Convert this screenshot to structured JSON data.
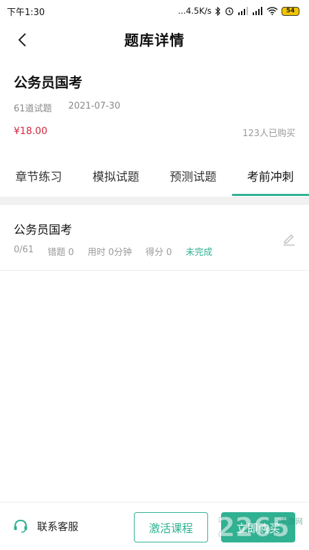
{
  "status_bar": {
    "time": "下午1:30",
    "network_speed": "...4.5K/s",
    "battery": "54"
  },
  "header": {
    "title": "题库详情"
  },
  "bank": {
    "title": "公务员国考",
    "question_count": "61道试题",
    "date": "2021-07-30",
    "price": "¥18.00",
    "buyers": "123人已购买"
  },
  "tabs": [
    {
      "label": "章节练习"
    },
    {
      "label": "模拟试题"
    },
    {
      "label": "预测试题"
    },
    {
      "label": "考前冲刺",
      "active": true
    }
  ],
  "exercise": {
    "title": "公务员国考",
    "progress": "0/61",
    "wrong": "错题 0",
    "time_used": "用时 0分钟",
    "score": "得分 0",
    "status": "未完成"
  },
  "bottom_bar": {
    "service_label": "联系客服",
    "activate_label": "激活课程",
    "buy_label": "立即购买"
  },
  "watermark": {
    "text": "2265",
    "sub": "手游网"
  },
  "colors": {
    "accent": "#2fb192",
    "price": "#d0253c",
    "muted": "#999999"
  }
}
